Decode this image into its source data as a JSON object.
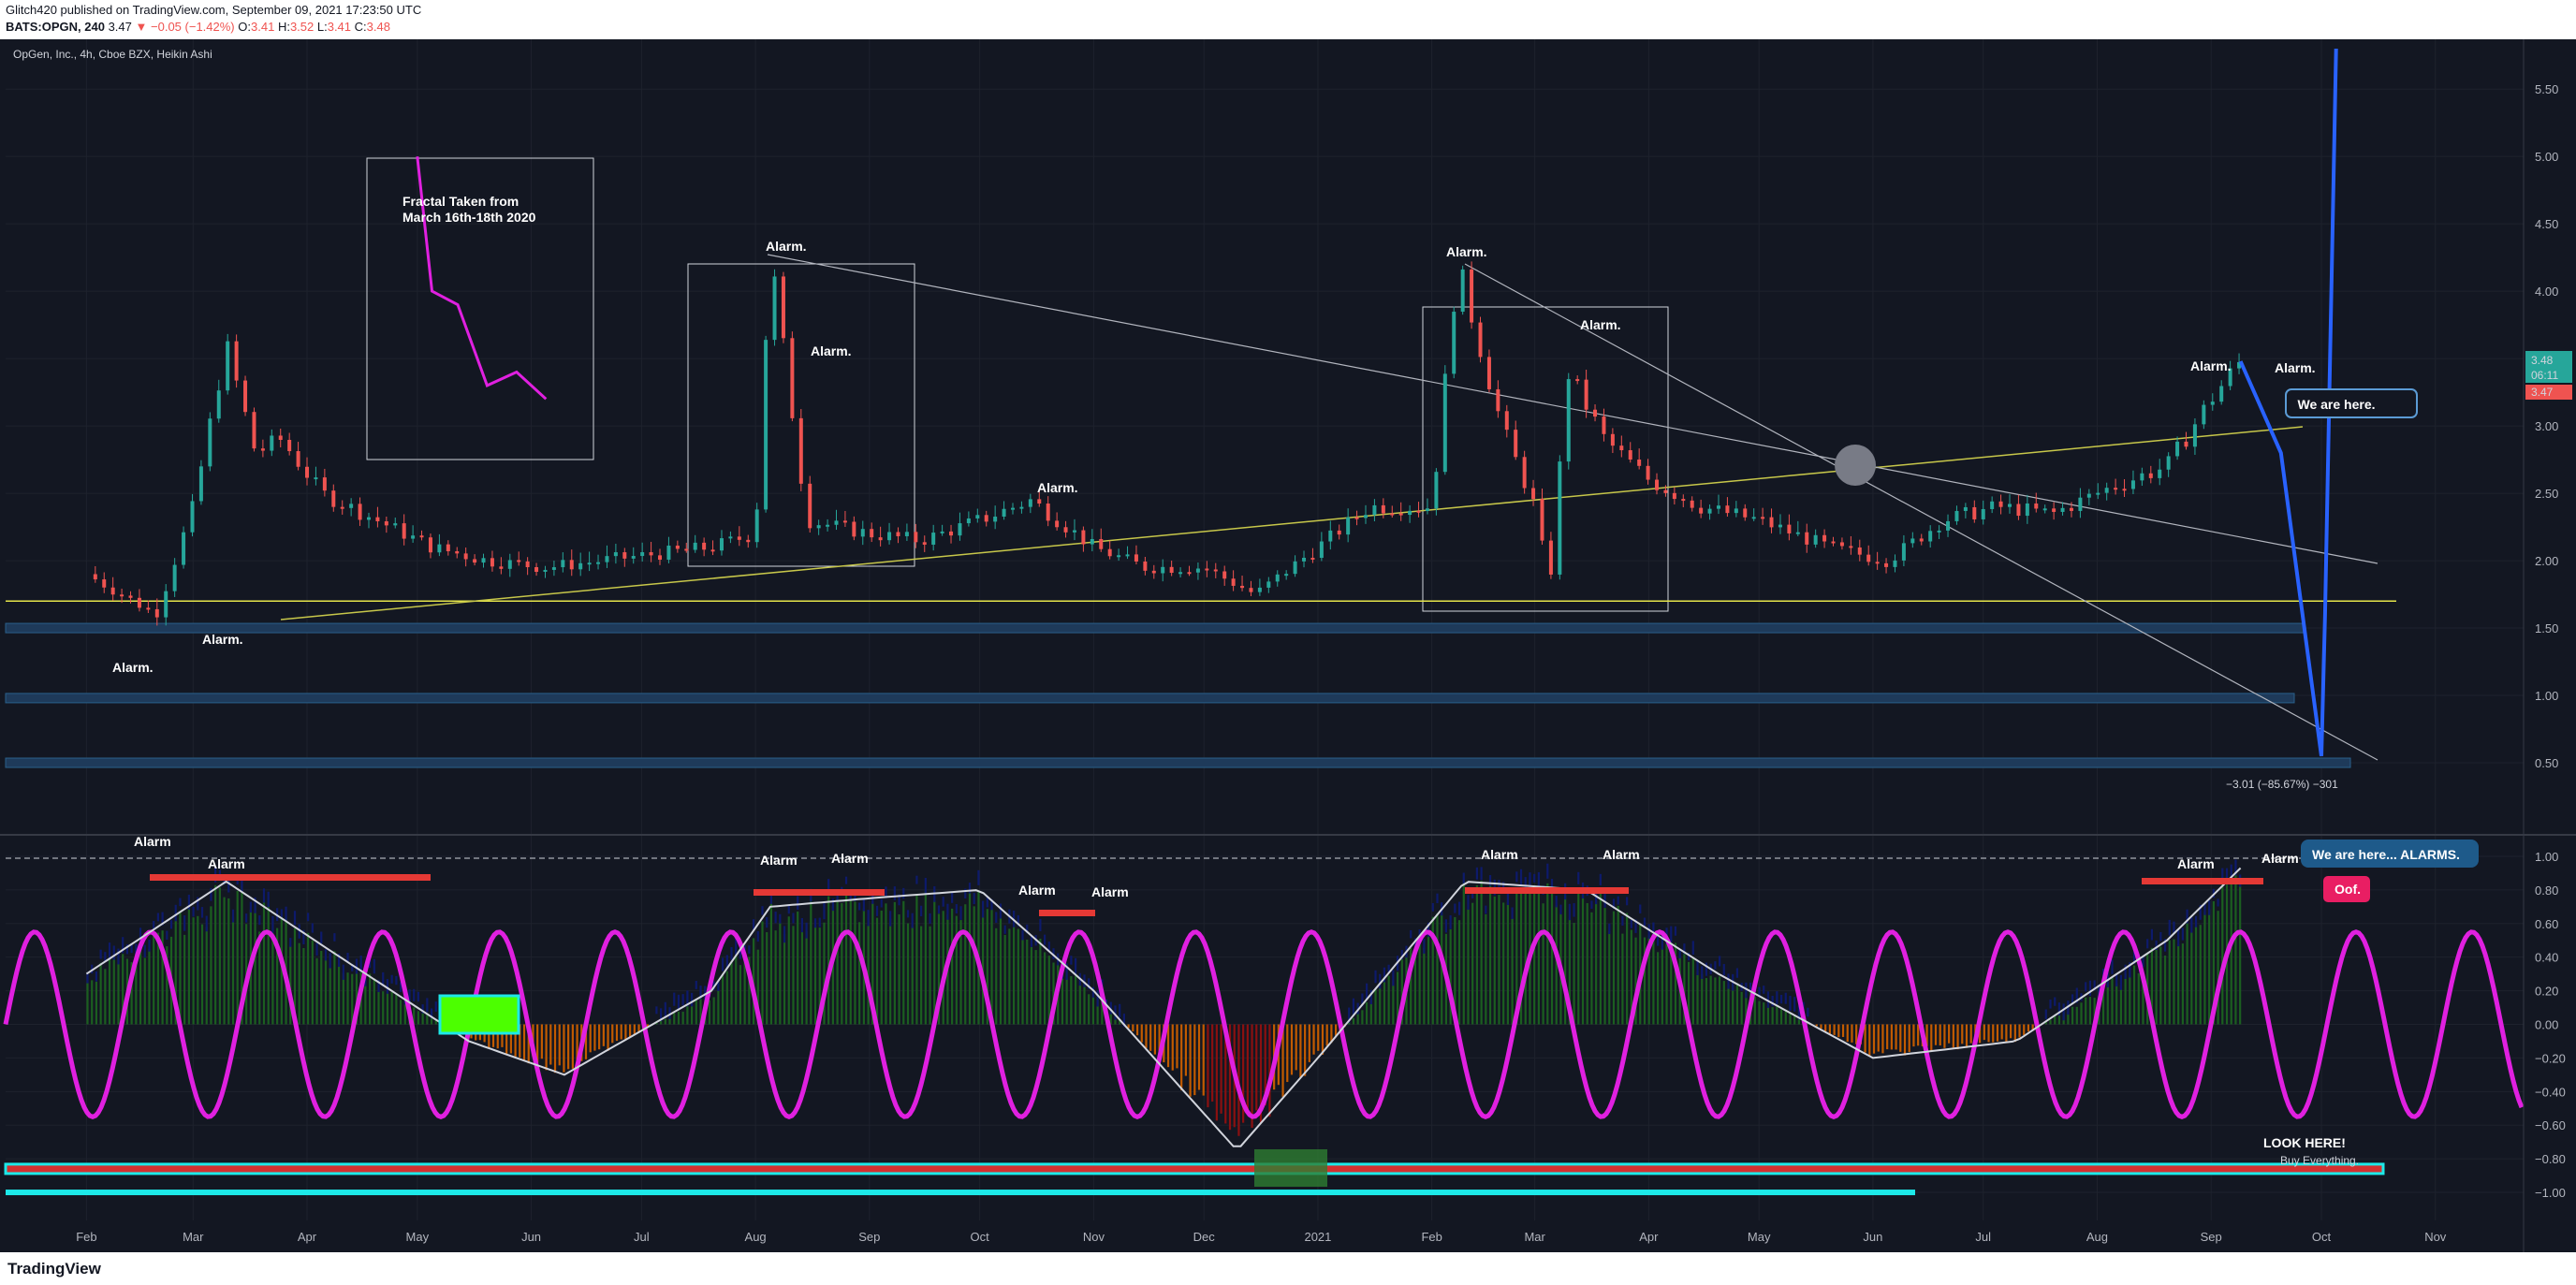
{
  "header": {
    "publish_line": "Glitch420 published on TradingView.com, September 09, 2021 17:23:50 UTC",
    "symbol": "BATS:OPGN, 240",
    "last": "3.47",
    "change": "−0.05 (−1.42%)",
    "o_label": "O:",
    "o": "3.41",
    "h_label": "H:",
    "h": "3.52",
    "l_label": "L:",
    "l": "3.41",
    "c_label": "C:",
    "c": "3.48"
  },
  "footer": {
    "brand": "TradingView"
  },
  "chart_data": {
    "type": "line",
    "title": "OpGen, Inc., 4h, Cboe BZX, Heikin Ashi",
    "x_ticks": [
      "Feb",
      "Mar",
      "Apr",
      "May",
      "Jun",
      "Jul",
      "Aug",
      "Sep",
      "Oct",
      "Nov",
      "Dec",
      "2021",
      "Feb",
      "Mar",
      "Apr",
      "May",
      "Jun",
      "Jul",
      "Aug",
      "Sep",
      "Oct",
      "Nov"
    ],
    "price_ticks": [
      "5.50",
      "5.00",
      "4.50",
      "4.00",
      "3.50",
      "3.00",
      "2.50",
      "2.00",
      "1.50",
      "1.00",
      "0.50"
    ],
    "osc_ticks": [
      "1.00",
      "0.80",
      "0.60",
      "0.40",
      "0.20",
      "0.00",
      "−0.20",
      "−0.40",
      "−0.60",
      "−0.80",
      "−1.00"
    ],
    "price_ylim": [
      0.0,
      5.8
    ],
    "osc_ylim": [
      -1.1,
      1.1
    ],
    "price_series": {
      "x": [
        "2020-02-01",
        "2020-02-20",
        "2020-03-01",
        "2020-03-10",
        "2020-03-18",
        "2020-03-25",
        "2020-04-05",
        "2020-04-20",
        "2020-05-05",
        "2020-05-20",
        "2020-06-05",
        "2020-06-20",
        "2020-07-05",
        "2020-07-20",
        "2020-08-01",
        "2020-08-05",
        "2020-08-15",
        "2020-09-01",
        "2020-09-15",
        "2020-10-01",
        "2020-10-15",
        "2020-11-01",
        "2020-11-15",
        "2020-12-01",
        "2020-12-15",
        "2021-01-01",
        "2021-01-15",
        "2021-02-01",
        "2021-02-08",
        "2021-02-20",
        "2021-03-01",
        "2021-03-05",
        "2021-03-10",
        "2021-03-20",
        "2021-04-01",
        "2021-04-15",
        "2021-05-01",
        "2021-05-20",
        "2021-06-05",
        "2021-06-20",
        "2021-07-05",
        "2021-07-20",
        "2021-08-05",
        "2021-08-20",
        "2021-09-01",
        "2021-09-09"
      ],
      "y": [
        1.9,
        1.6,
        2.4,
        3.6,
        2.8,
        2.9,
        2.5,
        2.3,
        2.1,
        2.0,
        1.95,
        2.0,
        2.05,
        2.1,
        2.2,
        4.3,
        2.3,
        2.2,
        2.15,
        2.3,
        2.45,
        2.1,
        1.95,
        1.95,
        1.75,
        2.1,
        2.4,
        2.4,
        4.2,
        3.0,
        2.4,
        1.8,
        3.4,
        2.9,
        2.6,
        2.4,
        2.3,
        2.1,
        2.0,
        2.3,
        2.4,
        2.35,
        2.55,
        2.7,
        3.2,
        3.48
      ]
    },
    "projection_series": {
      "x": [
        "2021-09-09",
        "2021-09-20",
        "2021-10-01",
        "2021-10-02",
        "2021-10-05"
      ],
      "y": [
        3.48,
        2.8,
        0.55,
        1.6,
        5.8
      ]
    },
    "fractal_series": {
      "x": [
        "2020-05-01",
        "2020-05-05",
        "2020-05-12",
        "2020-05-20",
        "2020-05-28",
        "2020-06-05"
      ],
      "y": [
        5.0,
        4.0,
        3.9,
        3.3,
        3.4,
        3.2
      ]
    },
    "osc_series": {
      "x": [
        "2020-02-01",
        "2020-03-10",
        "2020-04-10",
        "2020-05-15",
        "2020-06-10",
        "2020-07-20",
        "2020-08-05",
        "2020-09-01",
        "2020-10-01",
        "2020-11-01",
        "2020-12-10",
        "2021-01-01",
        "2021-02-10",
        "2021-03-15",
        "2021-04-20",
        "2021-06-01",
        "2021-07-10",
        "2021-08-20",
        "2021-09-09"
      ],
      "y": [
        0.3,
        0.85,
        0.4,
        -0.1,
        -0.3,
        0.2,
        0.7,
        0.75,
        0.8,
        0.2,
        -0.75,
        -0.2,
        0.85,
        0.8,
        0.3,
        -0.2,
        -0.1,
        0.5,
        0.93
      ]
    },
    "annotations": [
      {
        "text": "Fractal Taken from\nMarch 16th-18th 2020"
      },
      {
        "text": "Alarm."
      },
      {
        "text": "We are here."
      },
      {
        "text": "−3.01 (−85.67%) −301"
      },
      {
        "text": "Alarm"
      },
      {
        "text": "We are here... ALARMS."
      },
      {
        "text": "Oof."
      },
      {
        "text": "LOOK  HERE!"
      },
      {
        "text": "Buy Everything."
      }
    ],
    "price_labels": [
      "3.48",
      "06:11",
      "3.47"
    ],
    "colors": {
      "up": "#26a69a",
      "down": "#ef5350",
      "projection": "#2962ff",
      "sine": "#e020e0",
      "background": "#131722"
    },
    "grid": true
  }
}
